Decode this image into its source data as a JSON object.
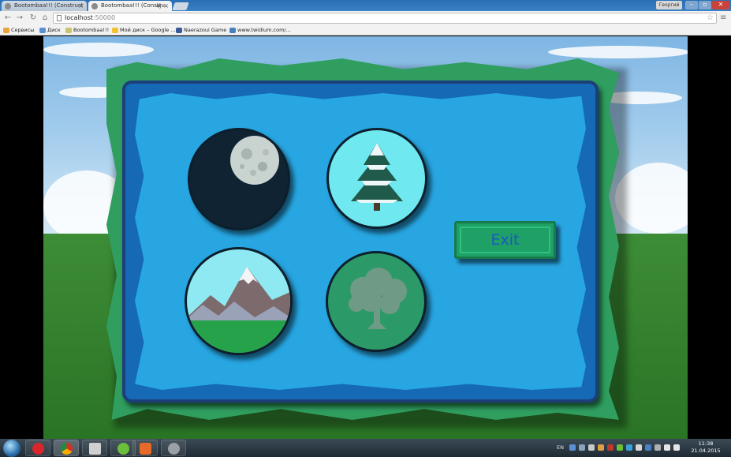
{
  "browser": {
    "tabs": [
      {
        "title": "Bootombaa!!! (Construct",
        "active": false
      },
      {
        "title": "Bootombaa!!! (Constru",
        "active": true
      }
    ],
    "profile_label": "Георгий",
    "address": {
      "host": "localhost",
      "port": ":50000"
    },
    "bookmarks": [
      {
        "label": "Сервисы",
        "icon": "apps-icon"
      },
      {
        "label": "Диск",
        "icon": "drive-icon"
      },
      {
        "label": "Bootombaa!!!",
        "icon": "page-icon"
      },
      {
        "label": "Мой диск – Google ...",
        "icon": "google-drive-icon"
      },
      {
        "label": "Naerazoui Game",
        "icon": "facebook-icon"
      },
      {
        "label": "www.twidium.com/...",
        "icon": "twidium-icon"
      }
    ]
  },
  "game": {
    "level_buttons": [
      {
        "name": "night-level",
        "icon": "moon-icon"
      },
      {
        "name": "winter-level",
        "icon": "snowy-tree-icon"
      },
      {
        "name": "mountain-level",
        "icon": "mountain-icon"
      },
      {
        "name": "forest-level",
        "icon": "tree-icon"
      }
    ],
    "exit_label": "Exit",
    "colors": {
      "frame": "#2f9e5f",
      "panel_border": "#1569b5",
      "panel_fill": "#27a6e2",
      "exit_button": "#1fa067",
      "exit_text": "#1c57c4"
    }
  },
  "taskbar": {
    "language": "EN",
    "time": "11:38",
    "date": "21.04.2015"
  }
}
